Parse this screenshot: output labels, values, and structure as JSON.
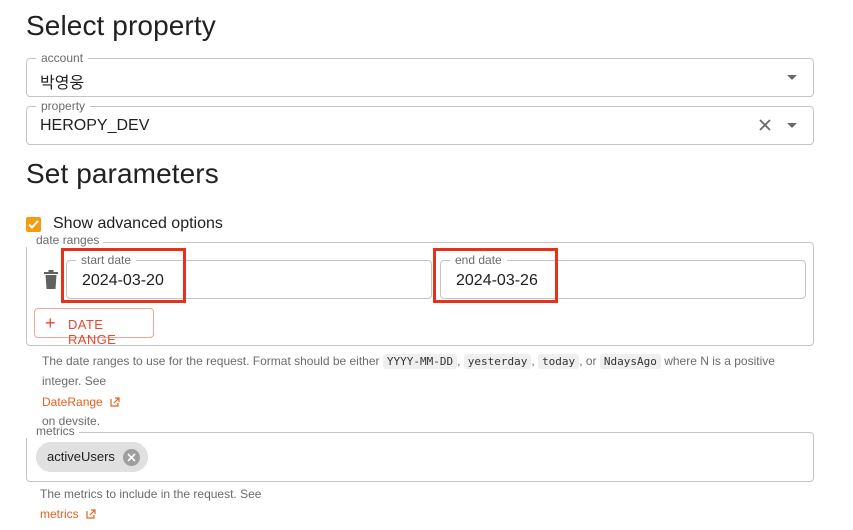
{
  "headings": {
    "select_property": "Select property",
    "set_parameters": "Set parameters"
  },
  "account": {
    "label": "account",
    "value": "박영웅"
  },
  "property": {
    "label": "property",
    "value": "HEROPY_DEV"
  },
  "advanced": {
    "label": "Show advanced options",
    "checked": true
  },
  "date_ranges": {
    "legend": "date ranges",
    "start": {
      "label": "start date",
      "value": "2024-03-20"
    },
    "end": {
      "label": "end date",
      "value": "2024-03-26"
    },
    "add_button": "DATE RANGE",
    "help_prefix": "The date ranges to use for the request. Format should be either",
    "help_codes": [
      "YYYY-MM-DD",
      "yesterday",
      "today",
      "NdaysAgo"
    ],
    "help_or": ", or",
    "help_suffix": "where N is a positive",
    "help_line2": "integer. See",
    "link": "DateRange",
    "help_after_link": "on devsite."
  },
  "metrics": {
    "legend": "metrics",
    "chip": "activeUsers",
    "help": "The metrics to include in the request. See",
    "link": "metrics"
  },
  "colors": {
    "accent": "#f39c12",
    "highlight": "#e8311a",
    "link": "#e8601c"
  }
}
